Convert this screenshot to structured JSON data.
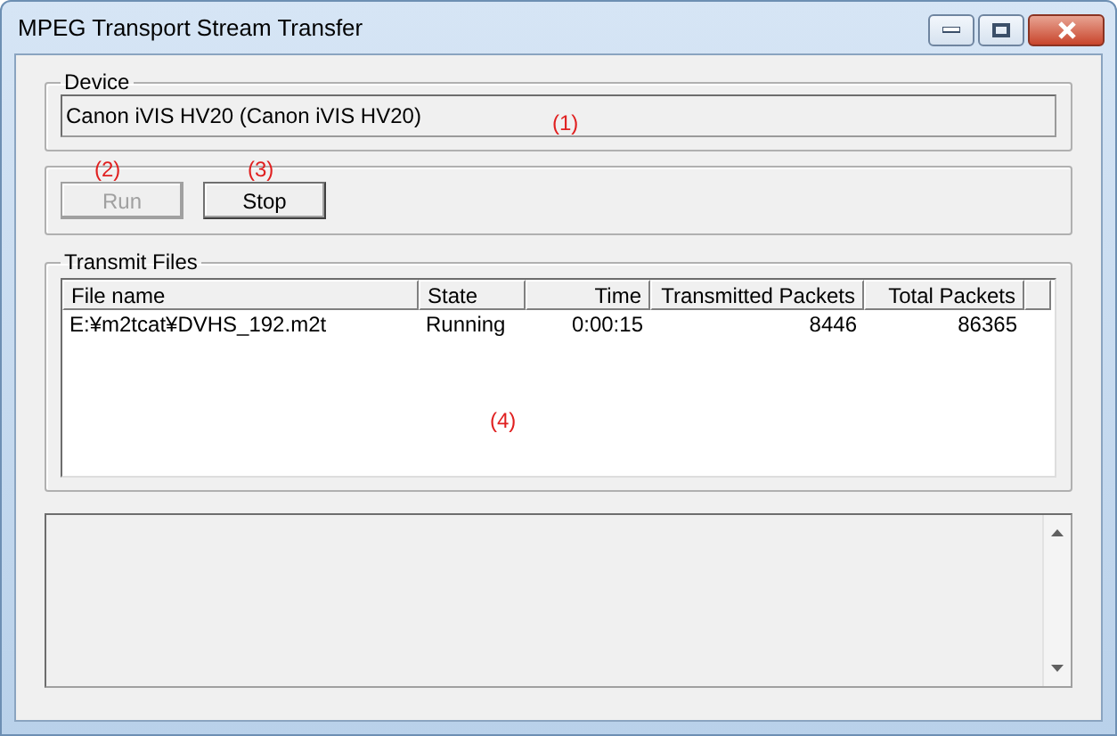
{
  "window": {
    "title": "MPEG Transport Stream Transfer"
  },
  "device": {
    "label": "Device",
    "value": "Canon iVIS HV20 (Canon iVIS HV20)"
  },
  "buttons": [
    {
      "label": "Run",
      "disabled": true
    },
    {
      "label": "Stop",
      "disabled": false
    }
  ],
  "transmit_files": {
    "label": "Transmit Files",
    "columns": [
      {
        "label": "File name",
        "kind": "text"
      },
      {
        "label": "State",
        "kind": "text"
      },
      {
        "label": "Time",
        "kind": "number"
      },
      {
        "label": "Transmitted Packets",
        "kind": "number"
      },
      {
        "label": "Total Packets",
        "kind": "number"
      }
    ],
    "rows": [
      [
        "E:¥m2tcat¥DVHS_192.m2t",
        "Running",
        "0:00:15",
        "8446",
        "86365"
      ]
    ]
  },
  "annotations": [
    "(1)",
    "(2)",
    "(3)",
    "(4)"
  ]
}
